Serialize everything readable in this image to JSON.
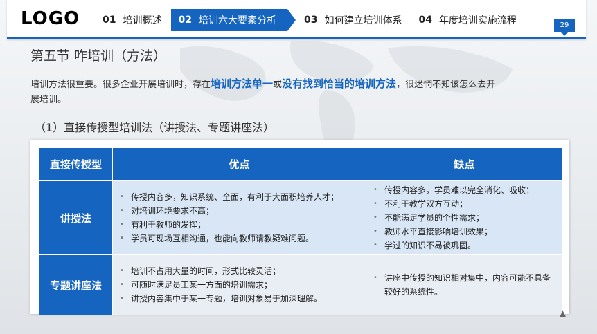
{
  "header": {
    "logo": "LOGO",
    "nav": [
      {
        "num": "01",
        "label": "培训概述"
      },
      {
        "num": "02",
        "label": "培训六大要素分析"
      },
      {
        "num": "03",
        "label": "如何建立培训体系"
      },
      {
        "num": "04",
        "label": "年度培训实施流程"
      }
    ],
    "page_number": "29"
  },
  "title": "第五节  咋培训（方法）",
  "intro": {
    "p1": "培训方法很重要。很多企业开展培训时，存在",
    "hl1": "培训方法单一",
    "p2": "或",
    "hl2": "没有找到恰当的培训方法",
    "p3": "，很迷惘不知该怎么去开展培训。"
  },
  "subtitle": "（1）直接传授型培训法（讲授法、专题讲座法）",
  "table": {
    "headers": [
      "直接传授型",
      "优点",
      "缺点"
    ],
    "rows": [
      {
        "name": "讲授法",
        "pros": [
          "传授内容多，知识系统、全面，有利于大面积培养人才；",
          "对培训环境要求不高；",
          "有利于教师的发挥；",
          "学员可现场互相沟通，也能向教师请教疑难问题。"
        ],
        "cons": [
          "传授内容多，学员难以完全消化、吸收；",
          "不利于教学双方互动；",
          "不能满足学员的个性需求；",
          "教师水平直接影响培训效果；",
          "学过的知识不易被巩固。"
        ]
      },
      {
        "name": "专题讲座法",
        "pros": [
          "培训不占用大量的时间，形式比较灵活；",
          "可随时满足员工某一方面的培训需求；",
          "讲授内容集中于某一专题，培训对象易于加深理解。"
        ],
        "cons": [
          "讲座中传授的知识相对集中，内容可能不具备较好的系统性。"
        ]
      }
    ]
  },
  "colors": {
    "accent": "#1565c0",
    "cell_light": "#d8e6f5"
  }
}
